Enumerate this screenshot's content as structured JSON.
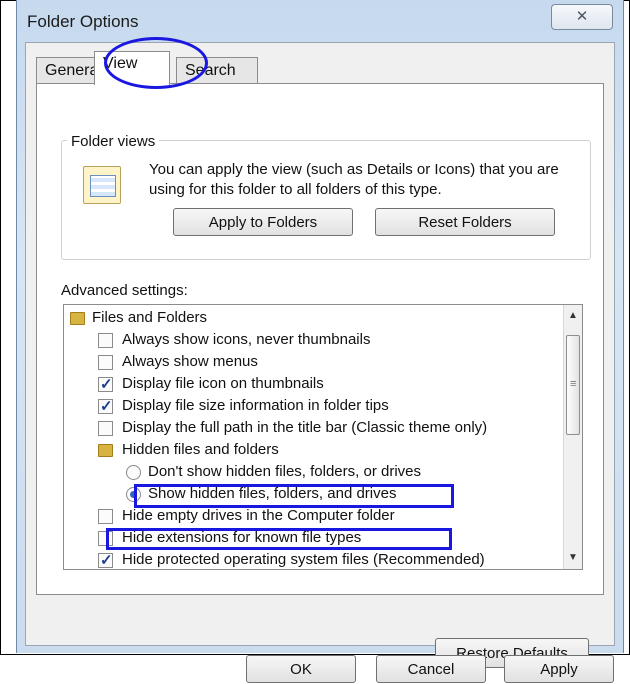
{
  "window": {
    "title": "Folder Options"
  },
  "tabs": [
    {
      "label": "General"
    },
    {
      "label": "View"
    },
    {
      "label": "Search"
    }
  ],
  "folder_views": {
    "group_label": "Folder views",
    "description": "You can apply the view (such as Details or Icons) that you are using for this folder to all folders of this type.",
    "apply_label": "Apply to Folders",
    "reset_label": "Reset Folders"
  },
  "advanced": {
    "label": "Advanced settings:",
    "items": [
      {
        "text": "Files and Folders"
      },
      {
        "text": "Always show icons, never thumbnails"
      },
      {
        "text": "Always show menus"
      },
      {
        "text": "Display file icon on thumbnails"
      },
      {
        "text": "Display file size information in folder tips"
      },
      {
        "text": "Display the full path in the title bar (Classic theme only)"
      },
      {
        "text": "Hidden files and folders"
      },
      {
        "text": "Don't show hidden files, folders, or drives"
      },
      {
        "text": "Show hidden files, folders, and drives"
      },
      {
        "text": "Hide empty drives in the Computer folder"
      },
      {
        "text": "Hide extensions for known file types"
      },
      {
        "text": "Hide protected operating system files (Recommended)"
      }
    ]
  },
  "buttons": {
    "restore_defaults": "Restore Defaults",
    "ok": "OK",
    "cancel": "Cancel",
    "apply": "Apply"
  },
  "colors": {
    "annotation_blue": "#1a17e0"
  }
}
